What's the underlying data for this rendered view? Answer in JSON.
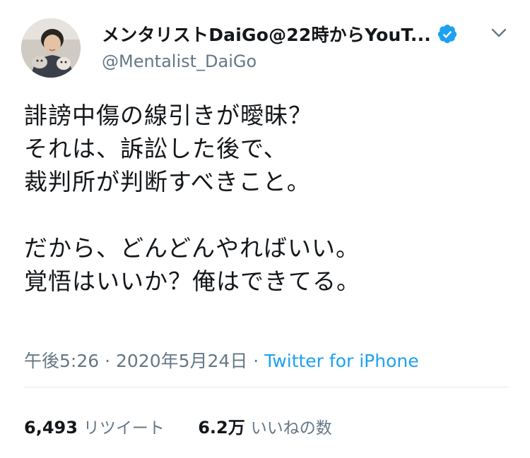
{
  "author": {
    "display_name": "メンタリストDaiGo@22時からYouT...",
    "handle": "@Mentalist_DaiGo",
    "verified": true
  },
  "tweet": {
    "lines": [
      "誹謗中傷の線引きが曖昧？",
      "それは、訴訟した後で、",
      "裁判所が判断すべきこと。",
      "",
      "だから、どんどんやればいい。",
      "覚悟はいいか？俺はできてる。"
    ],
    "time": "午後5:26",
    "separator1": " · ",
    "date": "2020年5月24日",
    "separator2": " · ",
    "source": "Twitter for iPhone"
  },
  "stats": {
    "retweets_count": "6,493",
    "retweets_label": "リツイート",
    "likes_count": "6.2万",
    "likes_label": "いいねの数"
  },
  "icons": {
    "verified": "verified-badge-icon",
    "menu": "chevron-down-icon"
  },
  "colors": {
    "accent": "#1da1f2",
    "text": "#14171a",
    "secondary": "#657786",
    "divider": "#e1e8ed"
  }
}
